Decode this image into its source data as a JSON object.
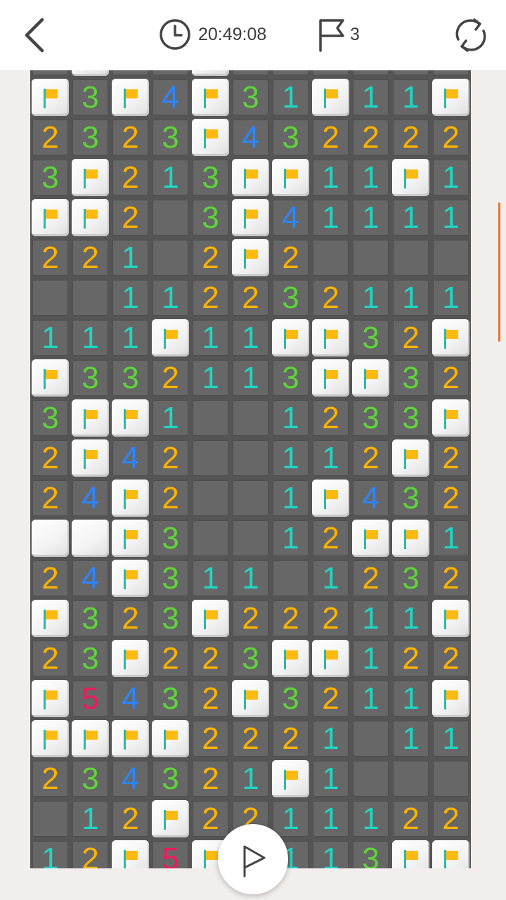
{
  "header": {
    "back_icon": "chevron-left-icon",
    "timer_icon": "clock-icon",
    "timer_text": "20:49:08",
    "flag_icon": "flag-outline-icon",
    "flag_count": "3",
    "restart_icon": "refresh-icon"
  },
  "colors": {
    "1": "#1fd6c4",
    "2": "#ffb300",
    "3": "#5fd33a",
    "4": "#2c86ff",
    "5": "#ee1b5c",
    "scroll_indicator": "#e0762c",
    "flag_color": "#ffba12"
  },
  "legend": {
    "F": "flagged covered cell",
    "C": "covered cell",
    "E": "revealed empty cell",
    "digits": "revealed cell showing adjacent mine count"
  },
  "board": {
    "columns": 11,
    "rows": [
      [
        "E",
        "C",
        "E",
        "E",
        "C",
        "E",
        "E",
        "E",
        "E",
        "E",
        "E"
      ],
      [
        "F",
        "3",
        "F",
        "4",
        "F",
        "3",
        "1",
        "F",
        "1",
        "1",
        "F"
      ],
      [
        "2",
        "3",
        "2",
        "3",
        "F",
        "4",
        "3",
        "2",
        "2",
        "2",
        "2"
      ],
      [
        "3",
        "F",
        "2",
        "1",
        "3",
        "F",
        "F",
        "1",
        "1",
        "F",
        "1"
      ],
      [
        "F",
        "F",
        "2",
        "E",
        "3",
        "F",
        "4",
        "1",
        "1",
        "1",
        "1"
      ],
      [
        "2",
        "2",
        "1",
        "E",
        "2",
        "F",
        "2",
        "E",
        "E",
        "E",
        "E"
      ],
      [
        "E",
        "E",
        "1",
        "1",
        "2",
        "2",
        "3",
        "2",
        "1",
        "1",
        "1"
      ],
      [
        "1",
        "1",
        "1",
        "F",
        "1",
        "1",
        "F",
        "F",
        "3",
        "2",
        "F"
      ],
      [
        "F",
        "3",
        "3",
        "2",
        "1",
        "1",
        "3",
        "F",
        "F",
        "3",
        "2"
      ],
      [
        "3",
        "F",
        "F",
        "1",
        "E",
        "E",
        "1",
        "2",
        "3",
        "3",
        "F"
      ],
      [
        "2",
        "F",
        "4",
        "2",
        "E",
        "E",
        "1",
        "1",
        "2",
        "F",
        "2"
      ],
      [
        "2",
        "4",
        "F",
        "2",
        "E",
        "E",
        "1",
        "F",
        "4",
        "3",
        "2"
      ],
      [
        "C",
        "C",
        "F",
        "3",
        "E",
        "E",
        "1",
        "2",
        "F",
        "F",
        "1"
      ],
      [
        "2",
        "4",
        "F",
        "3",
        "1",
        "1",
        "E",
        "1",
        "2",
        "3",
        "2"
      ],
      [
        "F",
        "3",
        "2",
        "3",
        "F",
        "2",
        "2",
        "2",
        "1",
        "1",
        "F"
      ],
      [
        "2",
        "3",
        "F",
        "2",
        "2",
        "3",
        "F",
        "F",
        "1",
        "2",
        "2"
      ],
      [
        "F",
        "5",
        "4",
        "3",
        "2",
        "F",
        "3",
        "2",
        "1",
        "1",
        "F"
      ],
      [
        "F",
        "F",
        "F",
        "F",
        "2",
        "2",
        "2",
        "1",
        "E",
        "1",
        "1"
      ],
      [
        "2",
        "3",
        "4",
        "3",
        "2",
        "1",
        "F",
        "1",
        "E",
        "E",
        "E"
      ],
      [
        "E",
        "1",
        "2",
        "F",
        "2",
        "2",
        "1",
        "1",
        "1",
        "2",
        "2"
      ],
      [
        "1",
        "2",
        "F",
        "5",
        "F",
        "E",
        "1",
        "1",
        "3",
        "F",
        "F"
      ]
    ]
  },
  "play_button_icon": "flag-outline-icon",
  "scroll_position": 0.23
}
